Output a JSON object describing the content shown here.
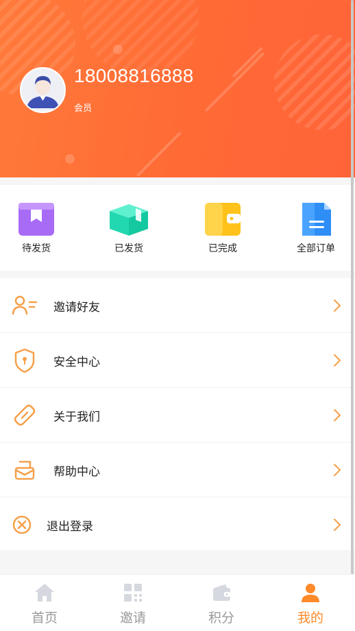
{
  "profile": {
    "phone": "18008816888",
    "role": "会员"
  },
  "orders": [
    {
      "label": "待发货",
      "icon": "purple-box-icon"
    },
    {
      "label": "已发货",
      "icon": "teal-package-icon"
    },
    {
      "label": "已完成",
      "icon": "yellow-wallet-icon"
    },
    {
      "label": "全部订单",
      "icon": "blue-document-icon"
    }
  ],
  "menu": [
    {
      "label": "邀请好友",
      "icon": "invite-user-icon"
    },
    {
      "label": "安全中心",
      "icon": "shield-lock-icon"
    },
    {
      "label": "关于我们",
      "icon": "link-icon"
    },
    {
      "label": "帮助中心",
      "icon": "message-box-icon"
    },
    {
      "label": "退出登录",
      "icon": "close-circle-icon"
    }
  ],
  "tabs": [
    {
      "label": "首页",
      "icon": "home-icon",
      "active": false
    },
    {
      "label": "邀请",
      "icon": "grid-icon",
      "active": false
    },
    {
      "label": "积分",
      "icon": "wallet-icon",
      "active": false
    },
    {
      "label": "我的",
      "icon": "user-icon",
      "active": true
    }
  ],
  "colors": {
    "header": "#ff6a35",
    "accent": "#ff8a2a",
    "menu_icon": "#f5a04a",
    "tab_inactive": "#9a9a9a"
  }
}
